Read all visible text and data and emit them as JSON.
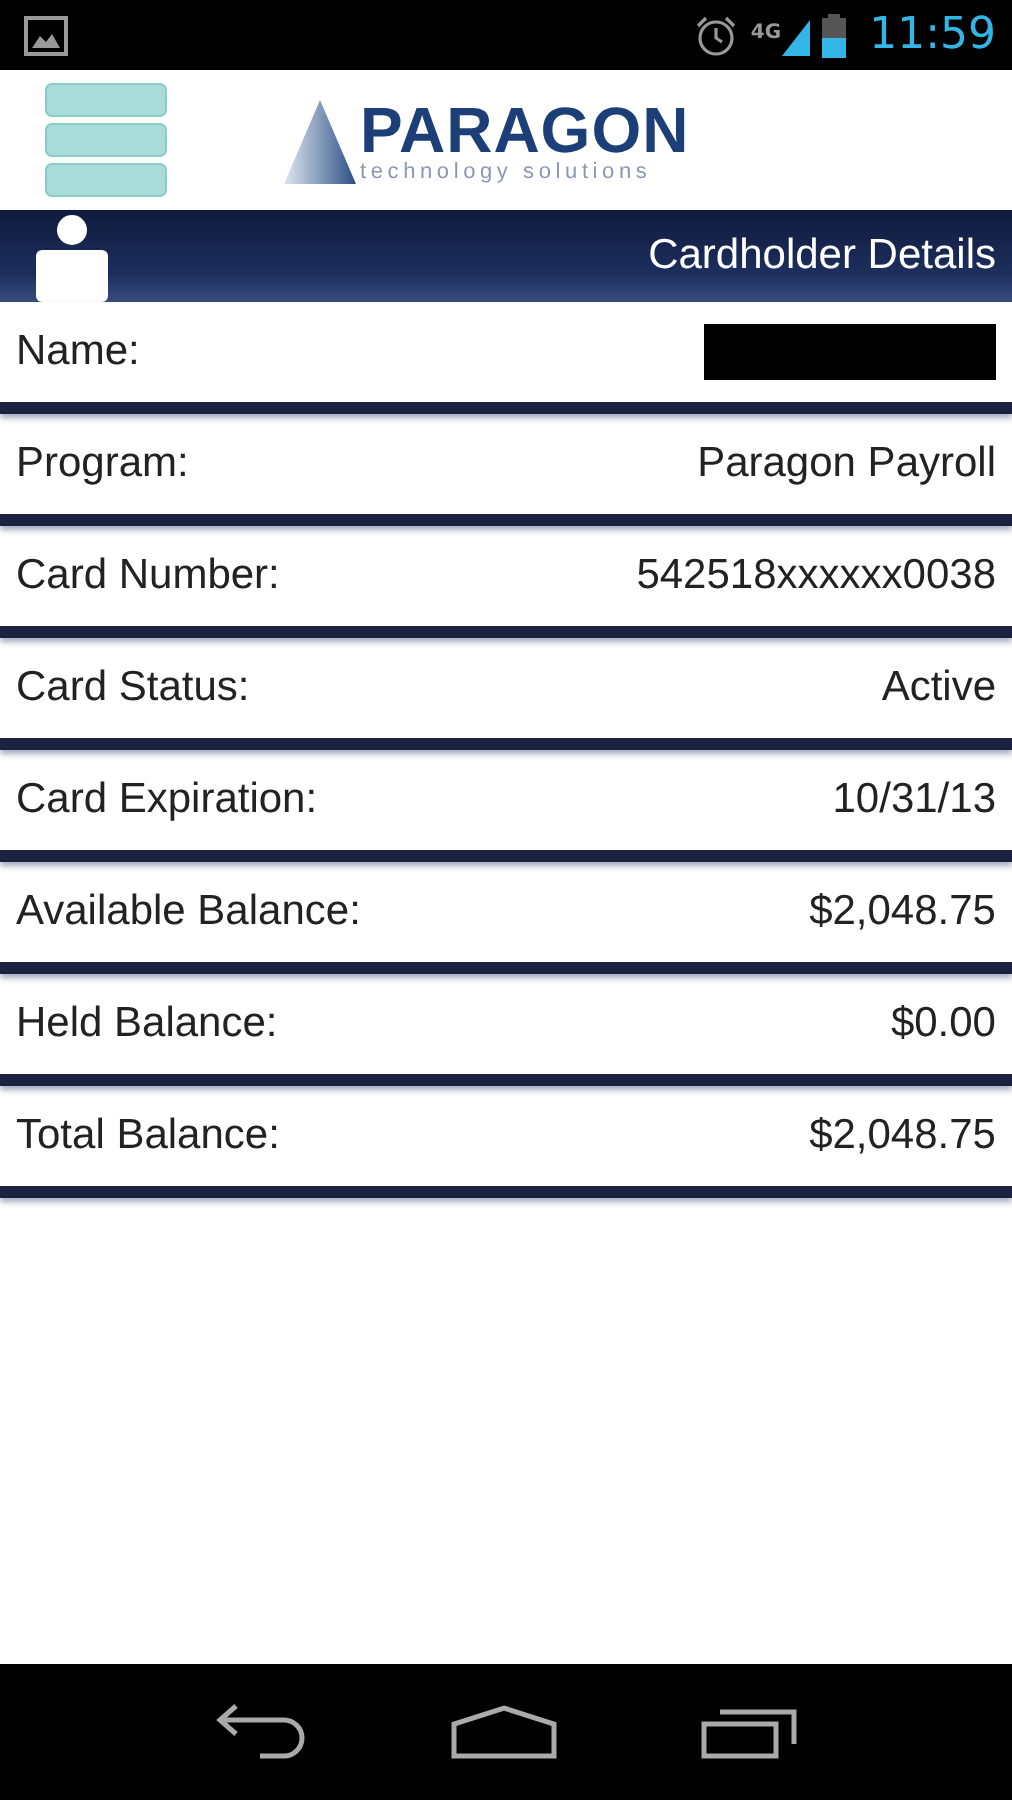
{
  "status_bar": {
    "network": "4G",
    "time": "11:59"
  },
  "header": {
    "logo": {
      "name": "PARAGON",
      "tagline": "technology solutions"
    }
  },
  "title_bar": {
    "title": "Cardholder Details"
  },
  "rows": [
    {
      "kind": "redacted",
      "label": "Name:"
    },
    {
      "kind": "text",
      "label": "Program:",
      "value": "Paragon Payroll"
    },
    {
      "kind": "text",
      "label": "Card Number:",
      "value": "542518xxxxxx0038"
    },
    {
      "kind": "text",
      "label": "Card Status:",
      "value": "Active"
    },
    {
      "kind": "text",
      "label": "Card Expiration:",
      "value": "10/31/13"
    },
    {
      "kind": "text",
      "label": "Available Balance:",
      "value": "$2,048.75"
    },
    {
      "kind": "text",
      "label": "Held Balance:",
      "value": "$0.00"
    },
    {
      "kind": "text",
      "label": "Total Balance:",
      "value": "$2,048.75"
    }
  ]
}
